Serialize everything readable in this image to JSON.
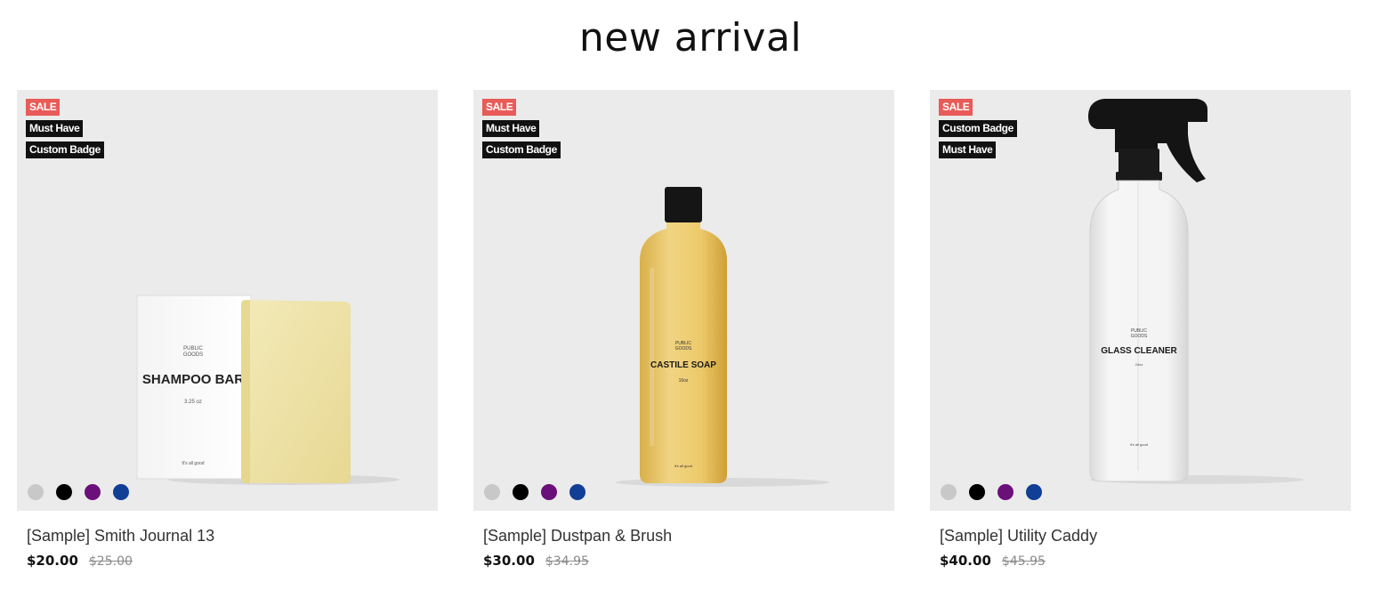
{
  "section": {
    "title": "new arrival"
  },
  "products": [
    {
      "badges": [
        "SALE",
        "Must Have",
        "Custom Badge"
      ],
      "image_label": {
        "brand_line1": "PUBLIC",
        "brand_line2": "GOODS",
        "name": "SHAMPOO BAR",
        "size": "3.25 oz",
        "tagline": "It's all good"
      },
      "swatches": [
        "#c8c8c8",
        "#000000",
        "#6b0f7a",
        "#113f95"
      ],
      "title": "[Sample] Smith Journal 13",
      "price": "$20.00",
      "old_price": "$25.00"
    },
    {
      "badges": [
        "SALE",
        "Must Have",
        "Custom Badge"
      ],
      "image_label": {
        "brand_line1": "PUBLIC",
        "brand_line2": "GOODS",
        "name": "CASTILE SOAP",
        "size": "16oz",
        "tagline": "it's all good"
      },
      "swatches": [
        "#c8c8c8",
        "#000000",
        "#6b0f7a",
        "#113f95"
      ],
      "title": "[Sample] Dustpan & Brush",
      "price": "$30.00",
      "old_price": "$34.95"
    },
    {
      "badges": [
        "SALE",
        "Custom Badge",
        "Must Have"
      ],
      "image_label": {
        "brand_line1": "PUBLIC",
        "brand_line2": "GOODS",
        "name": "GLASS CLEANER",
        "size": "24oz",
        "tagline": "it's all good"
      },
      "swatches": [
        "#c8c8c8",
        "#000000",
        "#6b0f7a",
        "#113f95"
      ],
      "title": "[Sample] Utility Caddy",
      "price": "$40.00",
      "old_price": "$45.95"
    }
  ]
}
